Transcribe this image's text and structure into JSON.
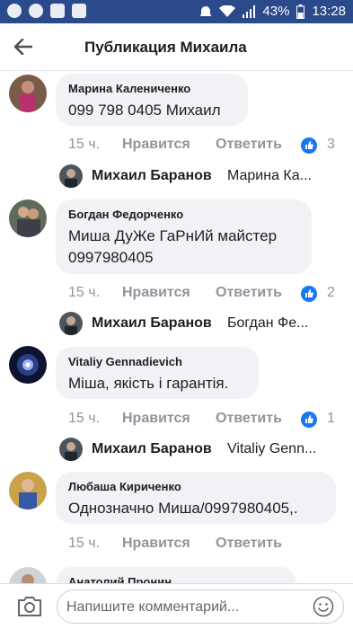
{
  "status_bar": {
    "battery": "43%",
    "time": "13:28"
  },
  "header": {
    "title": "Публикация Михаила"
  },
  "comments": [
    {
      "author": "Марина Калениченко",
      "text": "099 798 0405 Михаил",
      "time": "15 ч.",
      "like": "Нравится",
      "reply": "Ответить",
      "likes": "3",
      "reply_preview": {
        "name": "Михаил Баранов",
        "text": "Марина Ка..."
      }
    },
    {
      "author": "Богдан Федорченко",
      "text": "Миша ДуЖе ГаРнИй майстер\n0997980405",
      "time": "15 ч.",
      "like": "Нравится",
      "reply": "Ответить",
      "likes": "2",
      "reply_preview": {
        "name": "Михаил Баранов",
        "text": "Богдан Фе..."
      }
    },
    {
      "author": "Vitaliy Gennadievich",
      "text": "Міша, якість і гарантія.",
      "time": "15 ч.",
      "like": "Нравится",
      "reply": "Ответить",
      "likes": "1",
      "reply_preview": {
        "name": "Михаил Баранов",
        "text": "Vitaliy Genn..."
      }
    },
    {
      "author": "Любаша Кириченко",
      "text": "Однозначно Миша/0997980405,.",
      "time": "15 ч.",
      "like": "Нравится",
      "reply": "Ответить"
    },
    {
      "author": "Анатолий Пронин"
    }
  ],
  "composer": {
    "placeholder": "Напишите комментарий..."
  },
  "colors": {
    "status_bar": "#2b4a8c",
    "like_badge": "#1877f2",
    "bubble": "#f0f2f5",
    "meta_text": "#90949c"
  }
}
